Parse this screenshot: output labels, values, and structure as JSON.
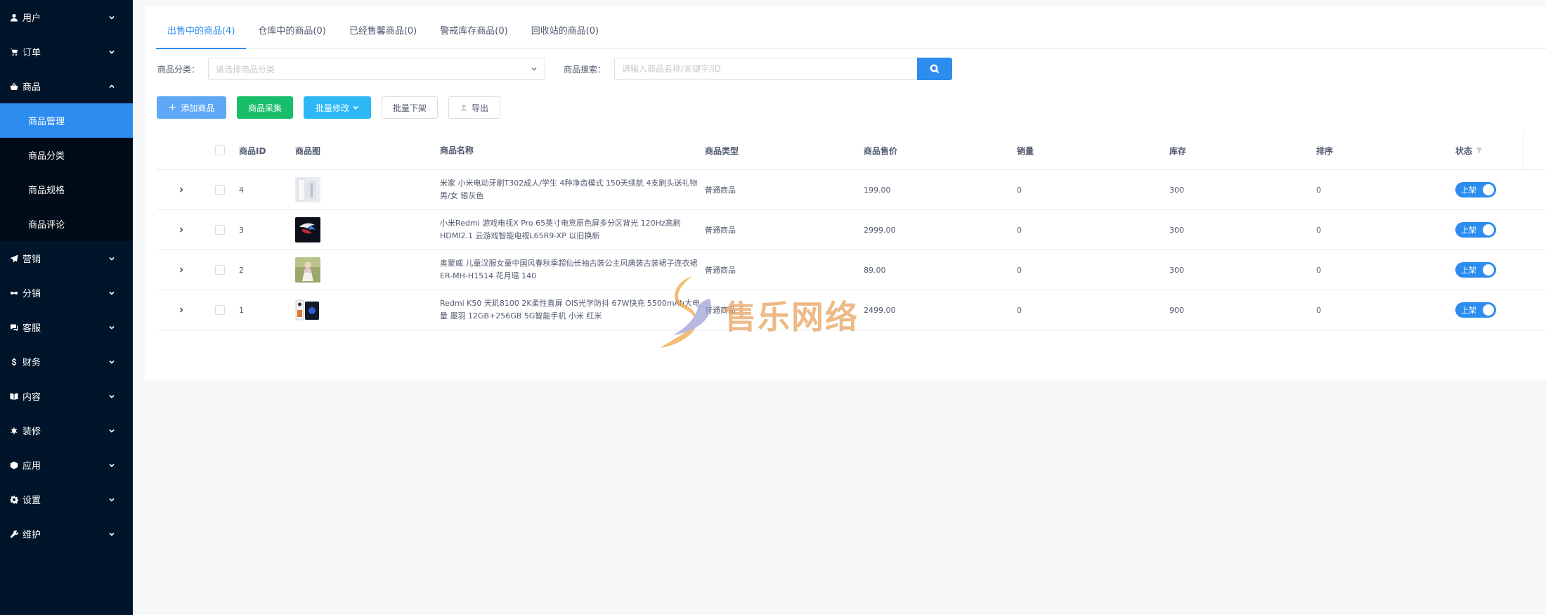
{
  "sidebar": {
    "items": [
      {
        "label": "用户",
        "icon": "user-icon",
        "expanded": false
      },
      {
        "label": "订单",
        "icon": "cart-icon",
        "expanded": false
      },
      {
        "label": "商品",
        "icon": "basket-icon",
        "expanded": true,
        "children": [
          {
            "label": "商品管理",
            "active": true
          },
          {
            "label": "商品分类",
            "active": false
          },
          {
            "label": "商品规格",
            "active": false
          },
          {
            "label": "商品评论",
            "active": false
          }
        ]
      },
      {
        "label": "营销",
        "icon": "send-icon",
        "expanded": false
      },
      {
        "label": "分销",
        "icon": "share-icon",
        "expanded": false
      },
      {
        "label": "客服",
        "icon": "chat-icon",
        "expanded": false
      },
      {
        "label": "财务",
        "icon": "dollar-icon",
        "expanded": false
      },
      {
        "label": "内容",
        "icon": "book-icon",
        "expanded": false
      },
      {
        "label": "装修",
        "icon": "decorate-icon",
        "expanded": false
      },
      {
        "label": "应用",
        "icon": "apps-icon",
        "expanded": false
      },
      {
        "label": "设置",
        "icon": "gear-icon",
        "expanded": false
      },
      {
        "label": "维护",
        "icon": "wrench-icon",
        "expanded": false
      }
    ]
  },
  "tabs": [
    {
      "label": "出售中的商品(4)",
      "active": true
    },
    {
      "label": "仓库中的商品(0)",
      "active": false
    },
    {
      "label": "已经售馨商品(0)",
      "active": false
    },
    {
      "label": "警戒库存商品(0)",
      "active": false
    },
    {
      "label": "回收站的商品(0)",
      "active": false
    }
  ],
  "filters": {
    "category_label": "商品分类：",
    "category_placeholder": "请选择商品分类",
    "search_label": "商品搜索：",
    "search_placeholder": "请输入商品名称/关键字/ID"
  },
  "actions": {
    "add": "添加商品",
    "collect": "商品采集",
    "batch_edit": "批量修改",
    "batch_off": "批量下架",
    "export": "导出"
  },
  "table": {
    "headers": {
      "id": "商品ID",
      "image": "商品图",
      "name": "商品名称",
      "type": "商品类型",
      "price": "商品售价",
      "sales": "销量",
      "stock": "库存",
      "sort": "排序",
      "status": "状态"
    },
    "rows": [
      {
        "id": "4",
        "name": "米家 小米电动牙刷T302成人/学生 4种净齿模式 150天续航 4支刷头送礼物男/女 银灰色",
        "type": "普通商品",
        "price": "199.00",
        "sales": "0",
        "stock": "300",
        "sort": "0",
        "status": "上架",
        "thumb": "toothbrush"
      },
      {
        "id": "3",
        "name": "小米Redmi 游戏电视X Pro 65英寸电竞原色屏多分区背光 120Hz高刷HDMI2.1 云游戏智能电视L65R9-XP 以旧换新",
        "type": "普通商品",
        "price": "2999.00",
        "sales": "0",
        "stock": "300",
        "sort": "0",
        "status": "上架",
        "thumb": "tv"
      },
      {
        "id": "2",
        "name": "奥蒙威 儿童汉服女童中国风春秋季超仙长袖古装公主风唐装古装裙子连衣裙 ER-MH-H1514 花月瑶 140",
        "type": "普通商品",
        "price": "89.00",
        "sales": "0",
        "stock": "300",
        "sort": "0",
        "status": "上架",
        "thumb": "dress"
      },
      {
        "id": "1",
        "name": "Redmi K50 天玑8100 2K柔性直屏 OIS光学防抖 67W快充 5500mAh大电量 墨羽 12GB+256GB 5G智能手机 小米 红米",
        "type": "普通商品",
        "price": "2499.00",
        "sales": "0",
        "stock": "900",
        "sort": "0",
        "status": "上架",
        "thumb": "phone"
      }
    ]
  },
  "watermark": {
    "text": "售乐网络"
  },
  "colors": {
    "primary": "#2d8cf0",
    "success": "#19be6b",
    "info": "#2db7f5",
    "sidebar": "#001529",
    "submenu": "#000c17"
  }
}
